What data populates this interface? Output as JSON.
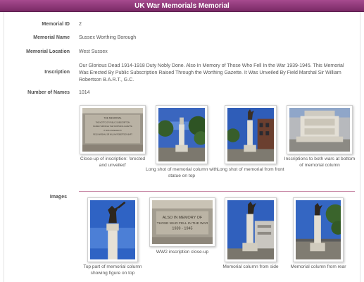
{
  "page": {
    "title": "UK War Memorials Memorial"
  },
  "fields": {
    "id": {
      "label": "Memorial ID",
      "value": "2"
    },
    "name": {
      "label": "Memorial Name",
      "value": "Sussex Worthing Borough"
    },
    "location": {
      "label": "Memorial Location",
      "value": "West Sussex"
    },
    "inscription": {
      "label": "Inscription",
      "value": "Our Glorious Dead 1914-1918 Duty Nobly Done. Also In Memory of Those Who Fell In the War 1939-1945. This Memorial Was Erected By Public Subscription Raised Through the Worthing Gazette. It Was Unveiled By Field Marshal Sir William Robertson B.A.R.T., G.C."
    },
    "names": {
      "label": "Number of Names",
      "value": "1014"
    }
  },
  "images_section": {
    "label": "Images"
  },
  "images": [
    {
      "caption": "Close-up of inscription: 'erected and unveiled'",
      "icon": "photo-inscription-icon"
    },
    {
      "caption": "Long shot of memorial column with statue on top",
      "icon": "photo-column-icon"
    },
    {
      "caption": "Long shot of memorial from front",
      "icon": "photo-front-icon"
    },
    {
      "caption": "Inscriptions to both wars at bottom of memorial column",
      "icon": "photo-base-icon"
    },
    {
      "caption": "Top part of memorial column showing figure on top",
      "icon": "photo-figure-icon"
    },
    {
      "caption": "WW2 inscription close-up",
      "icon": "photo-ww2-icon"
    },
    {
      "caption": "Memorial column from side",
      "icon": "photo-side-icon"
    },
    {
      "caption": "Memorial column from rear",
      "icon": "photo-rear-icon"
    }
  ],
  "photo_text": {
    "plaque1": [
      "THE MEMORIAL",
      "THE MOTTO OF PUBLIC SUBSCRIPTION",
      "RAISED THROUGH THE WORTHING GAZETTE",
      "IT WAS UNVEILED BY",
      "FIELD MARSHAL SIR WILLIAM ROBERTSON BART"
    ],
    "plaque2": [
      "ALSO IN MEMORY OF",
      "THOSE WHO FELL IN THE WAR",
      "1939 - 1945"
    ]
  },
  "colors": {
    "title_bar": "#8e3a7a",
    "divider": "#c98aa8",
    "sky": "#2f5db8"
  }
}
